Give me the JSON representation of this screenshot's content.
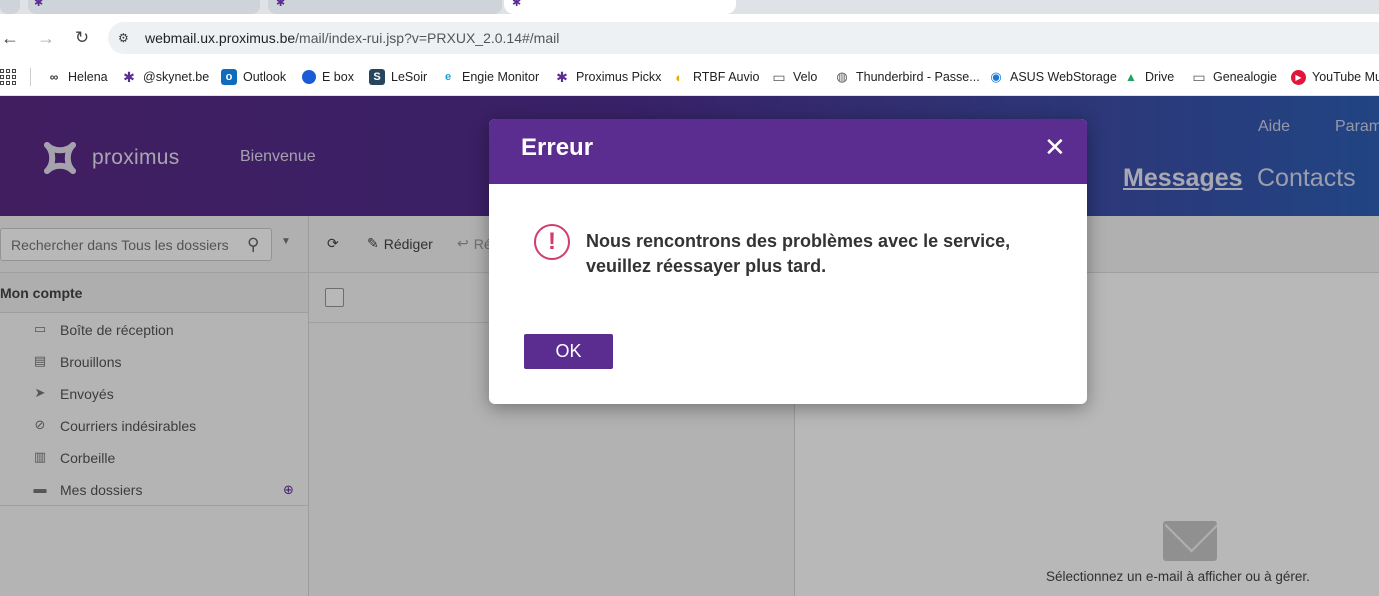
{
  "browser": {
    "url_host": "webmail.ux.proximus.be",
    "url_path": "/mail/index-rui.jsp?v=PRXUX_2.0.14#/mail",
    "bookmarks": [
      {
        "label": "Helena",
        "icon": "glasses-icon"
      },
      {
        "label": "@skynet.be",
        "icon": "proximus-icon"
      },
      {
        "label": "Outlook",
        "icon": "outlook-icon"
      },
      {
        "label": "E box",
        "icon": "ebox-icon"
      },
      {
        "label": "LeSoir",
        "icon": "lesoir-icon"
      },
      {
        "label": "Engie Monitor",
        "icon": "engie-icon"
      },
      {
        "label": "Proximus Pickx",
        "icon": "proximus-icon"
      },
      {
        "label": "RTBF Auvio",
        "icon": "rtbf-icon"
      },
      {
        "label": "Velo",
        "icon": "folder-icon"
      },
      {
        "label": "Thunderbird - Passe...",
        "icon": "globe-icon"
      },
      {
        "label": "ASUS WebStorage",
        "icon": "asus-icon"
      },
      {
        "label": "Drive",
        "icon": "drive-icon"
      },
      {
        "label": "Genealogie",
        "icon": "folder-icon"
      },
      {
        "label": "YouTube Mu",
        "icon": "youtube-music-icon"
      }
    ]
  },
  "header": {
    "logo_text": "proximus",
    "welcome": "Bienvenue",
    "links": {
      "help": "Aide",
      "settings": "Param"
    },
    "nav": {
      "messages": "Messages",
      "contacts": "Contacts"
    }
  },
  "sidebar": {
    "search_placeholder": "Rechercher dans Tous les dossiers",
    "account_title": "Mon compte",
    "folders": [
      {
        "label": "Boîte de réception",
        "icon": "inbox-icon"
      },
      {
        "label": "Brouillons",
        "icon": "draft-icon"
      },
      {
        "label": "Envoyés",
        "icon": "sent-icon"
      },
      {
        "label": "Courriers indésirables",
        "icon": "spam-icon"
      },
      {
        "label": "Corbeille",
        "icon": "trash-icon"
      },
      {
        "label": "Mes dossiers",
        "icon": "folder-icon"
      }
    ]
  },
  "mail_toolbar": {
    "compose": "Rédiger",
    "reply": "Ré"
  },
  "reading_pane": {
    "empty_message": "Sélectionnez un e-mail à afficher ou à gérer."
  },
  "dialog": {
    "title": "Erreur",
    "message_line1": "Nous rencontrons des problèmes avec le service,",
    "message_line2": "veuillez réessayer plus tard.",
    "ok_label": "OK"
  },
  "colors": {
    "brand_purple": "#5c2d91",
    "error_red": "#d23b6b"
  }
}
